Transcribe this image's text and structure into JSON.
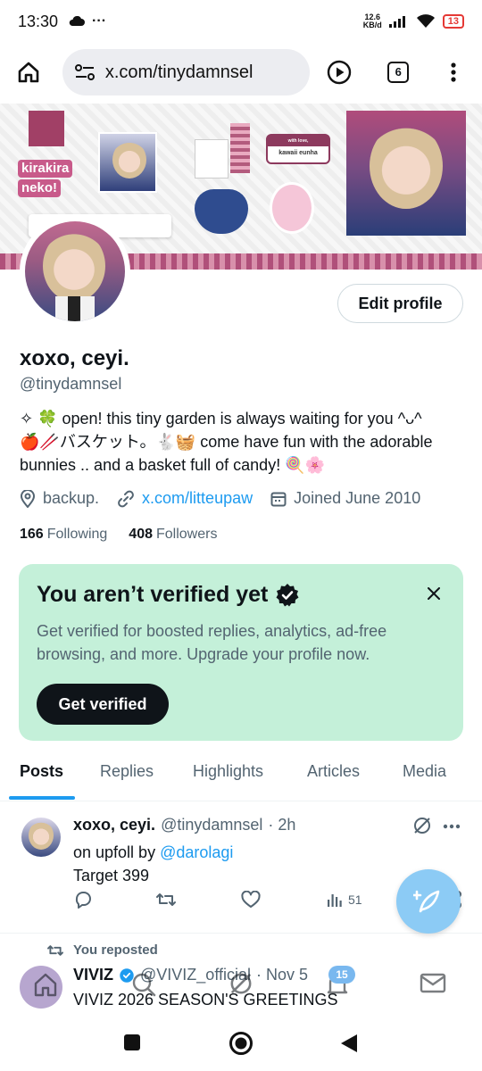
{
  "status_bar": {
    "time": "13:30",
    "net_speed_value": "12.6",
    "net_speed_unit": "KB/d",
    "battery": "13"
  },
  "browser": {
    "url": "x.com/tinydamnsel",
    "tab_count": "6"
  },
  "profile": {
    "banner_texts": {
      "kirakira": "kirakira",
      "neko": "neko!",
      "kawaii_top": "with love,",
      "kawaii_label": "kawaii eunha"
    },
    "edit_label": "Edit profile",
    "display_name": "xoxo, ceyi.",
    "handle": "@tinydamnsel",
    "bio_line1": "✧ 🍀 open! this tiny garden is always waiting for you ^ᴗ^",
    "bio_line2": "🍎🥢バスケット。🐇🧺 come have fun with the adorable",
    "bio_line3": "bunnies .. and a basket full of candy! 🍭🌸",
    "location": "backup.",
    "website": "x.com/litteupaw",
    "joined": "Joined June 2010",
    "following_count": "166",
    "following_label": "Following",
    "followers_count": "408",
    "followers_label": "Followers"
  },
  "verify_card": {
    "title": "You aren’t verified yet",
    "description": "Get verified for boosted replies, analytics, ad-free browsing, and more. Upgrade your profile now.",
    "button": "Get verified"
  },
  "tabs": [
    {
      "label": "Posts",
      "active": true
    },
    {
      "label": "Replies",
      "active": false
    },
    {
      "label": "Highlights",
      "active": false
    },
    {
      "label": "Articles",
      "active": false
    },
    {
      "label": "Media",
      "active": false
    }
  ],
  "tweet1": {
    "name": "xoxo, ceyi.",
    "handle": "@tinydamnsel",
    "time": "· 2h",
    "text_prefix": "on upfoll by ",
    "mention": "@darolagi",
    "text_line2": "Target 399",
    "views": "51"
  },
  "repost": {
    "label": "You reposted",
    "name": "VIVIZ",
    "handle": "@VIVIZ_official",
    "time": "· Nov 5",
    "text": "VIVIZ 2026 SEASON'S GREETINGS"
  },
  "bottom_nav": {
    "notification_count": "15"
  },
  "colors": {
    "accent": "#1d9bf0",
    "verify_bg": "#c4f0d9",
    "text_primary": "#0f1419",
    "text_secondary": "#536471"
  }
}
